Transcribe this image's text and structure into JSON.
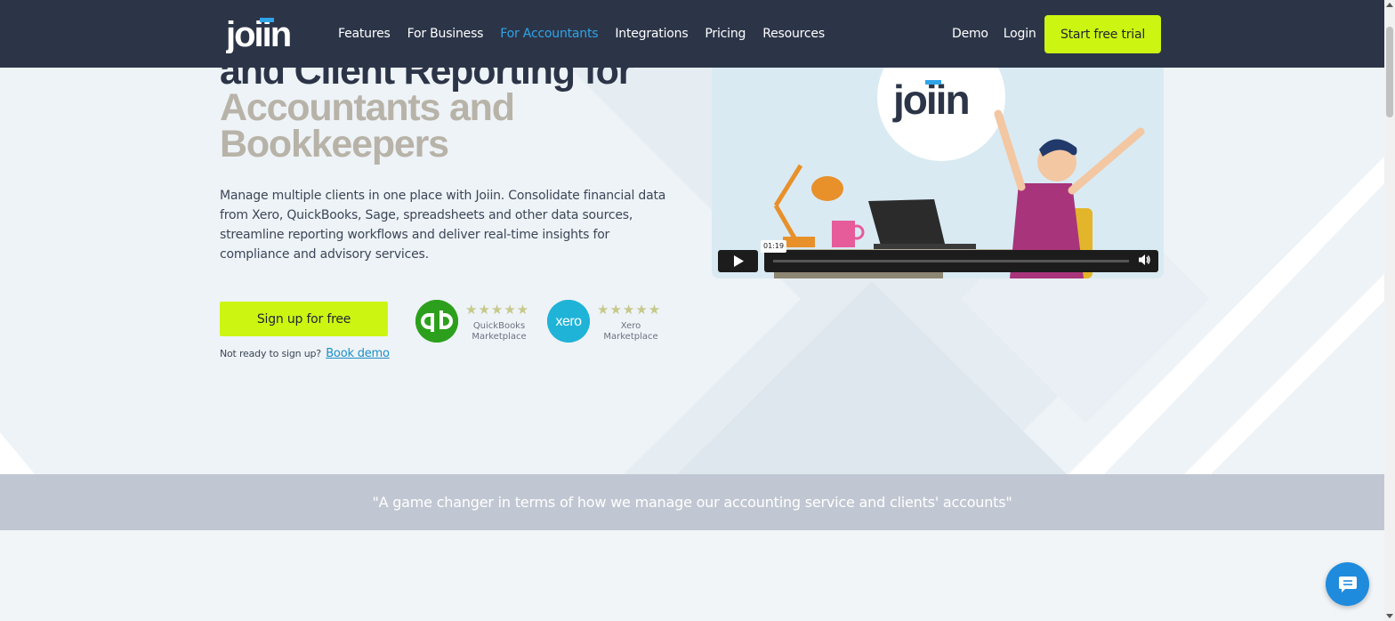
{
  "header": {
    "logo_text": "joiin",
    "nav": [
      {
        "label": "Features",
        "active": false
      },
      {
        "label": "For Business",
        "active": false
      },
      {
        "label": "For Accountants",
        "active": true
      },
      {
        "label": "Integrations",
        "active": false
      },
      {
        "label": "Pricing",
        "active": false
      },
      {
        "label": "Resources",
        "active": false
      }
    ],
    "demo_label": "Demo",
    "login_label": "Login",
    "trial_label": "Start free trial"
  },
  "hero": {
    "title_line1": "and Client Reporting for",
    "title_line2": "Accountants and",
    "title_line3": "Bookkeepers",
    "description": "Manage multiple clients in one place with Joiin. Consolidate financial data from Xero, QuickBooks, Sage, spreadsheets and other data sources, streamline reporting workflows and deliver real-time insights for compliance and advisory services.",
    "signup_label": "Sign up for free",
    "not_ready_text": "Not ready to sign up?",
    "book_demo_label": "Book demo"
  },
  "ratings": [
    {
      "badge": "qb",
      "stars": "★★★★★",
      "line1": "QuickBooks",
      "line2": "Marketplace"
    },
    {
      "badge": "xero",
      "stars": "★★★★★",
      "line1": "Xero",
      "line2": "Marketplace"
    }
  ],
  "video": {
    "logo_text": "joiin",
    "time": "01:19",
    "progress": 0
  },
  "quote": "\"A game changer in terms of how we manage our accounting service and clients' accounts\"",
  "colors": {
    "header_bg": "#2c3548",
    "accent_lime": "#ccf612",
    "active_link": "#2fa4e7",
    "quote_band": "#c1c7d2",
    "chat_bubble": "#1e8bdd"
  }
}
